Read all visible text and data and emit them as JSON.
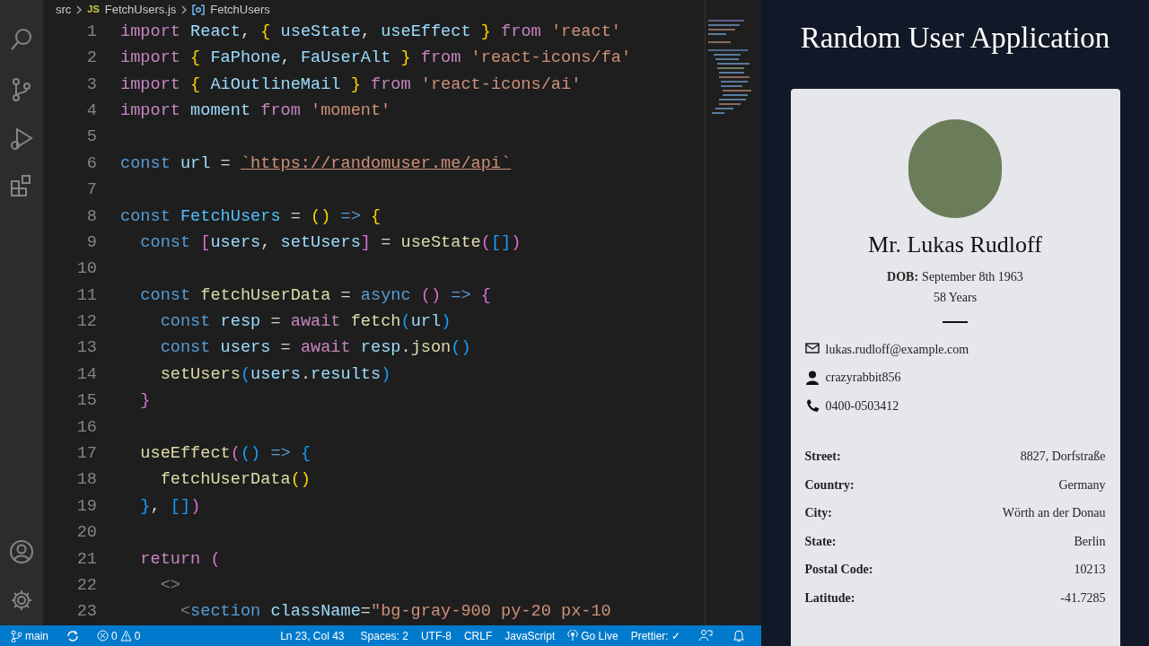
{
  "breadcrumb": {
    "folder": "src",
    "file_badge": "JS",
    "file": "FetchUsers.js",
    "symbol": "FetchUsers"
  },
  "code_lines": [
    {
      "number": "1",
      "tokens": [
        {
          "kind": "kw",
          "text": "import "
        },
        {
          "kind": "var",
          "text": "React"
        },
        {
          "kind": "p",
          "text": ", "
        },
        {
          "kind": "b1",
          "text": "{ "
        },
        {
          "kind": "var",
          "text": "useState"
        },
        {
          "kind": "p",
          "text": ", "
        },
        {
          "kind": "var",
          "text": "useEffect"
        },
        {
          "kind": "b1",
          "text": " }"
        },
        {
          "kind": "kw",
          "text": " from "
        },
        {
          "kind": "str",
          "text": "'react'"
        }
      ]
    },
    {
      "number": "2",
      "tokens": [
        {
          "kind": "kw",
          "text": "import "
        },
        {
          "kind": "b1",
          "text": "{ "
        },
        {
          "kind": "var",
          "text": "FaPhone"
        },
        {
          "kind": "p",
          "text": ", "
        },
        {
          "kind": "var",
          "text": "FaUserAlt"
        },
        {
          "kind": "b1",
          "text": " }"
        },
        {
          "kind": "kw",
          "text": " from "
        },
        {
          "kind": "str",
          "text": "'react-icons/fa'"
        }
      ]
    },
    {
      "number": "3",
      "tokens": [
        {
          "kind": "kw",
          "text": "import "
        },
        {
          "kind": "b1",
          "text": "{ "
        },
        {
          "kind": "var",
          "text": "AiOutlineMail"
        },
        {
          "kind": "b1",
          "text": " }"
        },
        {
          "kind": "kw",
          "text": " from "
        },
        {
          "kind": "str",
          "text": "'react-icons/ai'"
        }
      ]
    },
    {
      "number": "4",
      "tokens": [
        {
          "kind": "kw",
          "text": "import "
        },
        {
          "kind": "var",
          "text": "moment"
        },
        {
          "kind": "kw",
          "text": " from "
        },
        {
          "kind": "str",
          "text": "'moment'"
        }
      ]
    },
    {
      "number": "5"
    },
    {
      "number": "6",
      "tokens": [
        {
          "kind": "decl",
          "text": "const "
        },
        {
          "kind": "var",
          "text": "url"
        },
        {
          "kind": "p",
          "text": " = "
        },
        {
          "kind": "link",
          "text": "`https://randomuser.me/api`"
        }
      ]
    },
    {
      "number": "7"
    },
    {
      "number": "8",
      "tokens": [
        {
          "kind": "decl",
          "text": "const "
        },
        {
          "kind": "const",
          "text": "FetchUsers"
        },
        {
          "kind": "p",
          "text": " = "
        },
        {
          "kind": "b1",
          "text": "()"
        },
        {
          "kind": "decl",
          "text": " => "
        },
        {
          "kind": "b1",
          "text": "{"
        }
      ]
    },
    {
      "number": "9",
      "tokens": [
        {
          "kind": "decl",
          "text": "  const "
        },
        {
          "kind": "b2",
          "text": "["
        },
        {
          "kind": "var",
          "text": "users"
        },
        {
          "kind": "p",
          "text": ", "
        },
        {
          "kind": "var",
          "text": "setUsers"
        },
        {
          "kind": "b2",
          "text": "]"
        },
        {
          "kind": "p",
          "text": " = "
        },
        {
          "kind": "fn",
          "text": "useState"
        },
        {
          "kind": "b2",
          "text": "("
        },
        {
          "kind": "b3",
          "text": "[]"
        },
        {
          "kind": "b2",
          "text": ")"
        }
      ]
    },
    {
      "number": "10"
    },
    {
      "number": "11",
      "tokens": [
        {
          "kind": "decl",
          "text": "  const "
        },
        {
          "kind": "fn",
          "text": "fetchUserData"
        },
        {
          "kind": "p",
          "text": " = "
        },
        {
          "kind": "decl",
          "text": "async "
        },
        {
          "kind": "b2",
          "text": "()"
        },
        {
          "kind": "decl",
          "text": " => "
        },
        {
          "kind": "b2",
          "text": "{"
        }
      ]
    },
    {
      "number": "12",
      "tokens": [
        {
          "kind": "decl",
          "text": "    const "
        },
        {
          "kind": "var",
          "text": "resp"
        },
        {
          "kind": "p",
          "text": " = "
        },
        {
          "kind": "kw",
          "text": "await "
        },
        {
          "kind": "fn",
          "text": "fetch"
        },
        {
          "kind": "b3",
          "text": "("
        },
        {
          "kind": "var",
          "text": "url"
        },
        {
          "kind": "b3",
          "text": ")"
        }
      ]
    },
    {
      "number": "13",
      "tokens": [
        {
          "kind": "decl",
          "text": "    const "
        },
        {
          "kind": "var",
          "text": "users"
        },
        {
          "kind": "p",
          "text": " = "
        },
        {
          "kind": "kw",
          "text": "await "
        },
        {
          "kind": "var",
          "text": "resp"
        },
        {
          "kind": "p",
          "text": "."
        },
        {
          "kind": "fn",
          "text": "json"
        },
        {
          "kind": "b3",
          "text": "()"
        }
      ]
    },
    {
      "number": "14",
      "tokens": [
        {
          "kind": "fn",
          "text": "    setUsers"
        },
        {
          "kind": "b3",
          "text": "("
        },
        {
          "kind": "var",
          "text": "users"
        },
        {
          "kind": "p",
          "text": "."
        },
        {
          "kind": "var",
          "text": "results"
        },
        {
          "kind": "b3",
          "text": ")"
        }
      ]
    },
    {
      "number": "15",
      "tokens": [
        {
          "kind": "b2",
          "text": "  }"
        }
      ]
    },
    {
      "number": "16"
    },
    {
      "number": "17",
      "tokens": [
        {
          "kind": "fn",
          "text": "  useEffect"
        },
        {
          "kind": "b2",
          "text": "("
        },
        {
          "kind": "b3",
          "text": "()"
        },
        {
          "kind": "decl",
          "text": " => "
        },
        {
          "kind": "b3",
          "text": "{"
        }
      ]
    },
    {
      "number": "18",
      "tokens": [
        {
          "kind": "fn",
          "text": "    fetchUserData"
        },
        {
          "kind": "b1",
          "text": "()"
        }
      ]
    },
    {
      "number": "19",
      "tokens": [
        {
          "kind": "b3",
          "text": "  }"
        },
        {
          "kind": "p",
          "text": ", "
        },
        {
          "kind": "b3",
          "text": "[]"
        },
        {
          "kind": "b2",
          "text": ")"
        }
      ]
    },
    {
      "number": "20"
    },
    {
      "number": "21",
      "tokens": [
        {
          "kind": "kw",
          "text": "  return "
        },
        {
          "kind": "b2",
          "text": "("
        }
      ]
    },
    {
      "number": "22",
      "tokens": [
        {
          "kind": "tag",
          "text": "    <>"
        }
      ]
    },
    {
      "number": "23",
      "tokens": [
        {
          "kind": "tag",
          "text": "      <"
        },
        {
          "kind": "decl",
          "text": "section "
        },
        {
          "kind": "var",
          "text": "className"
        },
        {
          "kind": "p",
          "text": "="
        },
        {
          "kind": "str",
          "text": "\"bg-gray-900 py-20 px-10"
        }
      ]
    }
  ],
  "status_bar": {
    "branch": "main",
    "errors": "0",
    "warnings": "0",
    "items": [
      "Ln 23, Col 43",
      "Spaces: 2",
      "UTF-8",
      "CRLF",
      "JavaScript"
    ],
    "go_live": "Go Live",
    "prettier": "Prettier: ✓"
  },
  "app": {
    "title": "Random User Application",
    "name": "Mr. Lukas Rudloff",
    "dob_label": "DOB:",
    "dob": "September 8th 1963",
    "age": "58 Years",
    "contacts": [
      {
        "kind": "email",
        "text": "lukas.rudloff@example.com"
      },
      {
        "kind": "user",
        "text": "crazyrabbit856"
      },
      {
        "kind": "phone",
        "text": "0400-0503412"
      }
    ],
    "details": [
      {
        "label": "Street:",
        "value": "8827, Dorfstraße"
      },
      {
        "label": "Country:",
        "value": "Germany"
      },
      {
        "label": "City:",
        "value": "Wörth an der Donau"
      },
      {
        "label": "State:",
        "value": "Berlin"
      },
      {
        "label": "Postal Code:",
        "value": "10213"
      },
      {
        "label": "Latitude:",
        "value": "-41.7285"
      }
    ]
  }
}
